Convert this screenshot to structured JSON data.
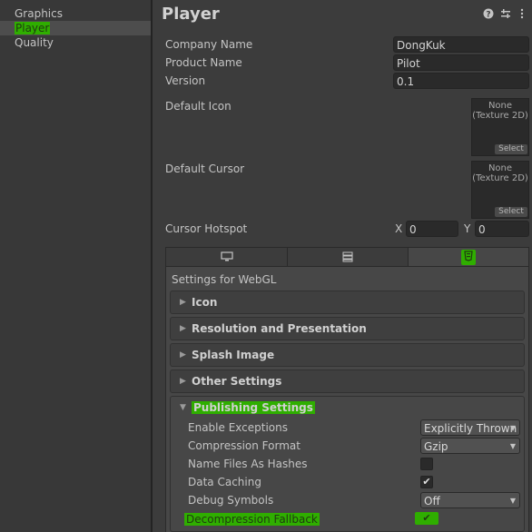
{
  "sidebar": {
    "items": [
      {
        "label": "Graphics"
      },
      {
        "label": "Player"
      },
      {
        "label": "Quality"
      }
    ]
  },
  "header": {
    "title": "Player",
    "icons": [
      "help-icon",
      "settings-sliders-icon",
      "more-options-icon"
    ]
  },
  "identity": {
    "company_label": "Company Name",
    "company_value": "DongKuk",
    "product_label": "Product Name",
    "product_value": "Pilot",
    "version_label": "Version",
    "version_value": "0.1"
  },
  "icons": {
    "default_icon_label": "Default Icon",
    "default_cursor_label": "Default Cursor",
    "texture_none": "None",
    "texture_type": "(Texture 2D)",
    "select_label": "Select"
  },
  "cursor_hotspot": {
    "label": "Cursor Hotspot",
    "x_label": "X",
    "x_value": "0",
    "y_label": "Y",
    "y_value": "0"
  },
  "platform_tabs": [
    "desktop-monitor-icon",
    "server-icon",
    "html5-webgl-icon"
  ],
  "settings_for": "Settings for WebGL",
  "sections": [
    {
      "title": "Icon"
    },
    {
      "title": "Resolution and Presentation"
    },
    {
      "title": "Splash Image"
    },
    {
      "title": "Other Settings"
    }
  ],
  "publishing": {
    "title": "Publishing Settings",
    "enable_exceptions_label": "Enable Exceptions",
    "enable_exceptions_value": "Explicitly Thrown",
    "compression_label": "Compression Format",
    "compression_value": "Gzip",
    "name_files_label": "Name Files As Hashes",
    "name_files_checked": false,
    "data_caching_label": "Data Caching",
    "data_caching_checked": true,
    "debug_symbols_label": "Debug Symbols",
    "debug_symbols_value": "Off",
    "decompression_label": "Decompression Fallback",
    "decompression_checked": true
  },
  "colors": {
    "highlight": "#2fae00",
    "background": "#383838"
  }
}
